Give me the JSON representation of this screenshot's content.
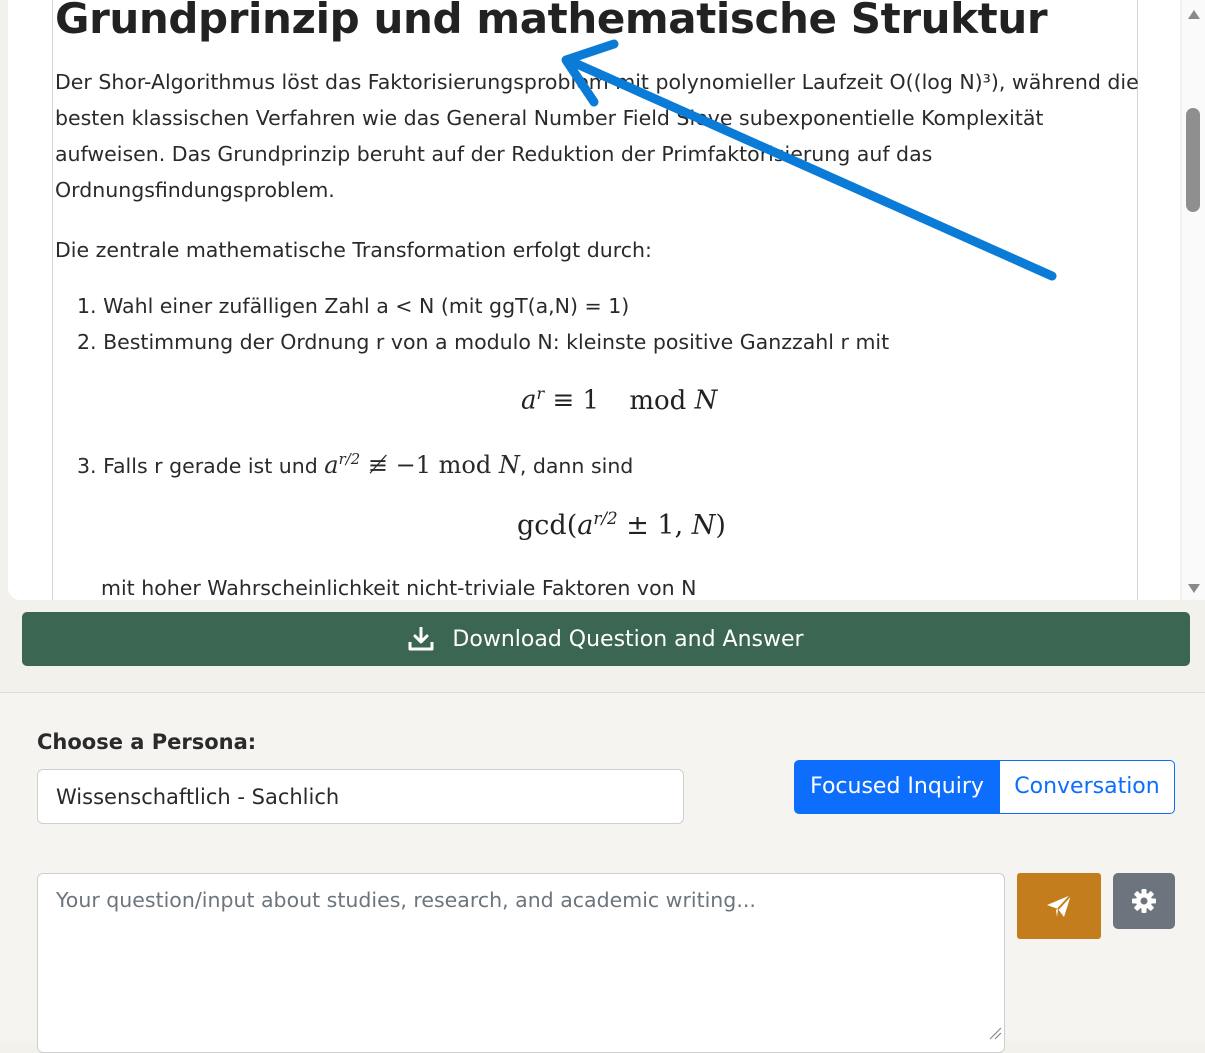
{
  "answer": {
    "heading": "Grundprinzip und mathematische Struktur",
    "paragraph1": "Der Shor-Algorithmus löst das Faktorisierungsproblem mit polynomieller Laufzeit O((log N)³), während die besten klassischen Verfahren wie das General Number Field Sieve subexponentielle Komplexität aufweisen. Das Grundprinzip beruht auf der Reduktion der Primfaktorisierung auf das Ordnungsfindungsproblem.",
    "paragraph2": "Die zentrale mathematische Transformation erfolgt durch:",
    "list": {
      "item1": "1. Wahl einer zufälligen Zahl a < N (mit ggT(a,N) = 1)",
      "item2": "2. Bestimmung der Ordnung r von a modulo N: kleinste positive Ganzzahl r mit",
      "item3_prefix": "3. Falls r gerade ist und",
      "item3_suffix": ", dann sind",
      "item3_continued": "mit hoher Wahrscheinlichkeit nicht-triviale Faktoren von N"
    },
    "equation1": {
      "base": "a",
      "exp": "r",
      "rel": "≡ 1",
      "mod": "mod",
      "modulus": "N"
    },
    "equation_inline": {
      "base": "a",
      "exp": "r/2",
      "rel": "≢ −1",
      "mod": "mod",
      "modulus": "N"
    },
    "equation2": {
      "func": "gcd(",
      "base": "a",
      "exp": "r/2",
      "rest": " ± 1, ",
      "modulus": "N",
      "close": ")"
    },
    "annotation_color": "#0a7bd6"
  },
  "download_button": {
    "label": "Download Question and Answer",
    "icon": "download-icon",
    "color": "#3b6651"
  },
  "persona": {
    "label": "Choose a Persona:",
    "selected": "Wissenschaftlich - Sachlich"
  },
  "modes": {
    "focused": "Focused Inquiry",
    "conversation": "Conversation",
    "active": "focused",
    "accent": "#0d6efd"
  },
  "question": {
    "value": "",
    "placeholder": "Your question/input about studies, research, and academic writing..."
  },
  "send_button": {
    "icon": "paper-plane-icon",
    "color": "#c47d1d"
  },
  "settings_button": {
    "icon": "gear-icon",
    "color": "#6c757d"
  }
}
